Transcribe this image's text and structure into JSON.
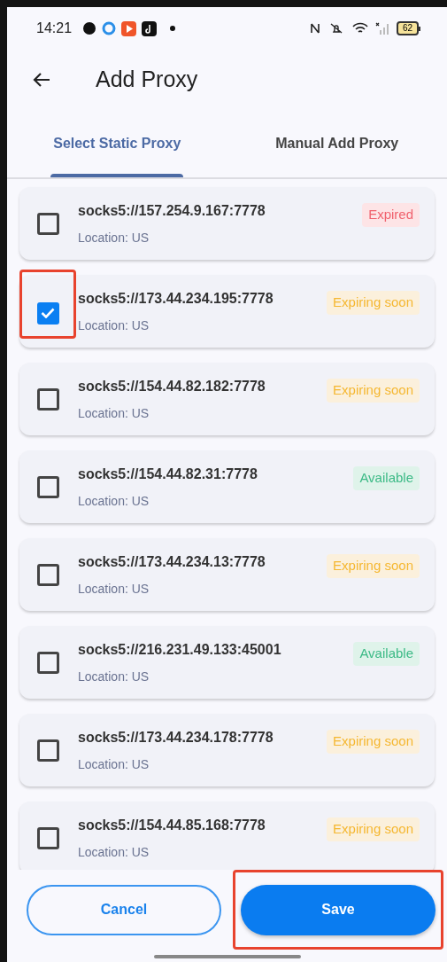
{
  "status_bar": {
    "time": "14:21",
    "battery": "62"
  },
  "app_bar": {
    "title": "Add Proxy"
  },
  "tabs": [
    {
      "label": "Select Static Proxy",
      "selected": true
    },
    {
      "label": "Manual Add Proxy",
      "selected": false
    }
  ],
  "proxies": [
    {
      "address": "socks5://157.254.9.167:7778",
      "location": "Location: US",
      "status": "Expired",
      "kind": "expired",
      "checked": false,
      "highlighted": false
    },
    {
      "address": "socks5://173.44.234.195:7778",
      "location": "Location: US",
      "status": "Expiring soon",
      "kind": "expiring",
      "checked": true,
      "highlighted": true
    },
    {
      "address": "socks5://154.44.82.182:7778",
      "location": "Location: US",
      "status": "Expiring soon",
      "kind": "expiring",
      "checked": false,
      "highlighted": false
    },
    {
      "address": "socks5://154.44.82.31:7778",
      "location": "Location: US",
      "status": "Available",
      "kind": "available",
      "checked": false,
      "highlighted": false
    },
    {
      "address": "socks5://173.44.234.13:7778",
      "location": "Location: US",
      "status": "Expiring soon",
      "kind": "expiring",
      "checked": false,
      "highlighted": false
    },
    {
      "address": "socks5://216.231.49.133:45001",
      "location": "Location: US",
      "status": "Available",
      "kind": "available",
      "checked": false,
      "highlighted": false
    },
    {
      "address": "socks5://173.44.234.178:7778",
      "location": "Location: US",
      "status": "Expiring soon",
      "kind": "expiring",
      "checked": false,
      "highlighted": false
    },
    {
      "address": "socks5://154.44.85.168:7778",
      "location": "Location: US",
      "status": "Expiring soon",
      "kind": "expiring",
      "checked": false,
      "highlighted": false
    }
  ],
  "buttons": [
    {
      "label": "Cancel",
      "kind": "outline",
      "highlighted": false
    },
    {
      "label": "Save",
      "kind": "filled",
      "highlighted": true
    }
  ]
}
